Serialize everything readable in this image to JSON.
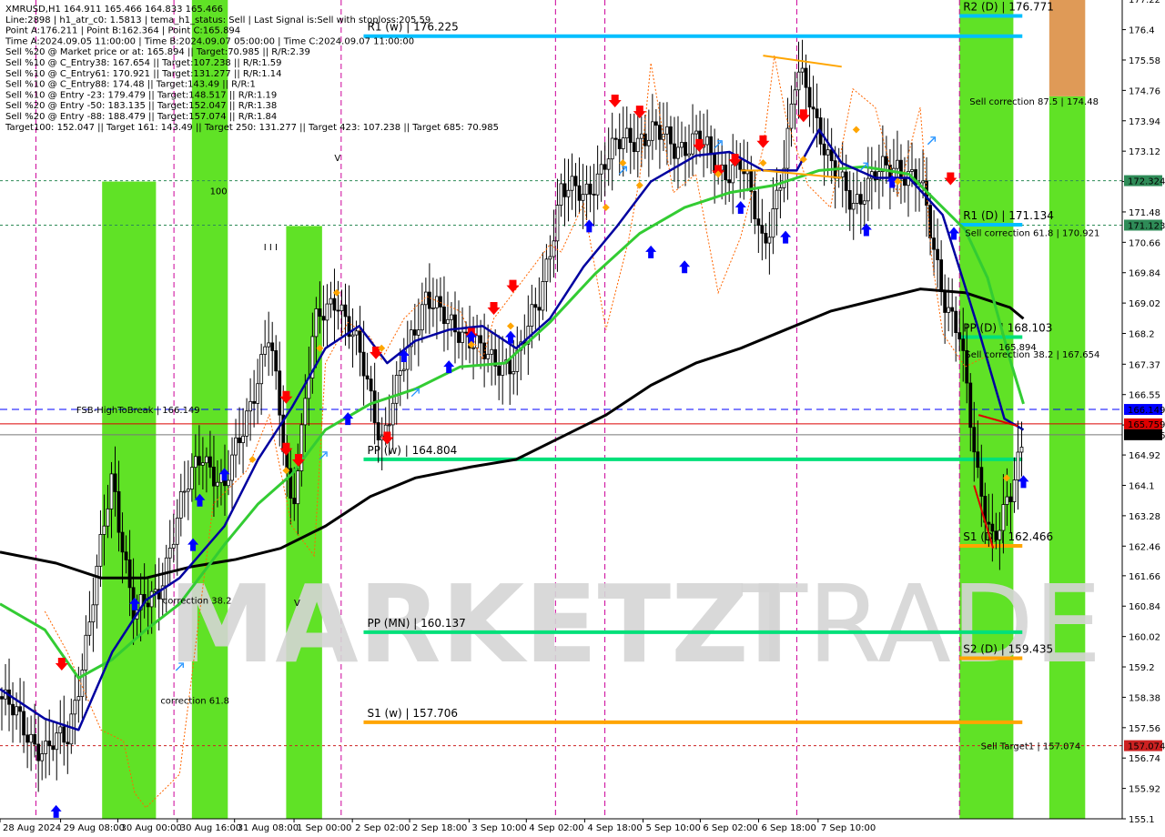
{
  "header": {
    "lines": [
      "XMRUSD,H1  164.911 165.466 164.833 165.466",
      "Line:2898 | h1_atr_c0: 1.5813 | tema_h1_status: Sell | Last Signal is:Sell with stoploss:205.59",
      "Point A:176.211 | Point B:162.364 | Point C:165.894",
      "Time A:2024.09.05 11:00:00 | Time B:2024.09.07 05:00:00 | Time C:2024.09.07 11:00:00",
      "Sell %20 @ Market price or at: 165.894 || Target:70.985 || R/R:2.39",
      "Sell %10 @ C_Entry38: 167.654 || Target:107.238 || R/R:1.59",
      "Sell %10 @ C_Entry61: 170.921 || Target:131.277 || R/R:1.14",
      "Sell %10 @ C_Entry88: 174.48 || Target:143.49 || R/R:1",
      "Sell %10 @ Entry -23: 179.479 || Target:148.517 || R/R:1.19",
      "Sell %20 @ Entry -50: 183.135 || Target:152.047 || R/R:1.38",
      "Sell %20 @ Entry -88: 188.479 || Target:157.074 || R/R:1.84",
      "Target100: 152.047 || Target 161: 143.49 || Target 250: 131.277 || Target 423: 107.238 || Target 685: 70.985"
    ]
  },
  "watermark": {
    "left": "MARKETZI",
    "right": "TRADE"
  },
  "colors": {
    "bull": "#000000",
    "bear": "#000000",
    "ma_slow": "#000000",
    "ma_mid": "#0000a0",
    "ma_fast": "#33cc33",
    "zone_green": "#44dd00",
    "zone_orange": "#d9883a",
    "pivot_green": "#00e07a",
    "pivot_cyan": "#00bfff",
    "pivot_orange": "#ffa500",
    "buy_arrow": "#0000ff",
    "sell_arrow": "#ff0000"
  },
  "chart_data": {
    "type": "candlestick",
    "symbol": "XMRUSD",
    "timeframe": "H1",
    "ylim": [
      155.1,
      177.2
    ],
    "y_ticks": [
      177.22,
      176.4,
      175.58,
      174.76,
      173.94,
      173.12,
      172.3,
      171.48,
      170.66,
      169.84,
      169.02,
      168.2,
      167.37,
      166.55,
      165.73,
      164.92,
      164.1,
      163.28,
      162.46,
      161.66,
      160.84,
      160.02,
      159.2,
      158.38,
      157.56,
      156.74,
      155.92,
      155.1
    ],
    "x_labels": [
      "28 Aug 2024",
      "29 Aug 08:00",
      "30 Aug 00:00",
      "30 Aug 16:00",
      "31 Aug 08:00",
      "1 Sep 00:00",
      "2 Sep 02:00",
      "2 Sep 18:00",
      "3 Sep 10:00",
      "4 Sep 02:00",
      "4 Sep 18:00",
      "5 Sep 10:00",
      "6 Sep 02:00",
      "6 Sep 18:00",
      "7 Sep 10:00"
    ],
    "price_tags": [
      {
        "value": 172.324,
        "label": "172.324",
        "bg": "#2e8b57",
        "fg": "#ffffff"
      },
      {
        "value": 171.123,
        "label": "171.123",
        "bg": "#2e8b57",
        "fg": "#ffffff"
      },
      {
        "value": 166.149,
        "label": "166.149",
        "bg": "#0000ff",
        "fg": "#ffffff"
      },
      {
        "value": 165.759,
        "label": "165.759",
        "bg": "#dd0000",
        "fg": "#ffffff"
      },
      {
        "value": 165.466,
        "label": "165.466",
        "bg": "#000000",
        "fg": "#ffffff"
      },
      {
        "value": 157.074,
        "label": "157.074",
        "bg": "#cc2222",
        "fg": "#ffffff"
      }
    ],
    "levels": [
      {
        "label": "R2 (D) | 176.771",
        "value": 176.771,
        "t0": 0.855,
        "t1": 0.911,
        "color": "#00bfff",
        "text_color": "#000000"
      },
      {
        "label": "R1 (w) | 176.225",
        "value": 176.225,
        "t0": 0.324,
        "t1": 0.911,
        "color": "#00bfff",
        "text_color": "#000000"
      },
      {
        "label": "R1 (D) | 171.134",
        "value": 171.134,
        "t0": 0.855,
        "t1": 0.911,
        "color": "#00bfff",
        "text_color": "#000000"
      },
      {
        "label": "PP (D) | 168.103",
        "value": 168.103,
        "t0": 0.855,
        "t1": 0.911,
        "color": "#00e07a",
        "text_color": "#000000"
      },
      {
        "label": "PP (w) | 164.804",
        "value": 164.804,
        "t0": 0.324,
        "t1": 0.911,
        "color": "#00e07a",
        "text_color": "#000000"
      },
      {
        "label": "S1 (D) | 162.466",
        "value": 162.466,
        "t0": 0.855,
        "t1": 0.911,
        "color": "#ffa500",
        "text_color": "#000000"
      },
      {
        "label": "PP (MN) | 160.137",
        "value": 160.137,
        "t0": 0.324,
        "t1": 0.911,
        "color": "#00e07a",
        "text_color": "#000000"
      },
      {
        "label": "S2 (D) | 159.435",
        "value": 159.435,
        "t0": 0.855,
        "t1": 0.911,
        "color": "#ffa500",
        "text_color": "#000000"
      },
      {
        "label": "S1 (w) | 157.706",
        "value": 157.706,
        "t0": 0.324,
        "t1": 0.911,
        "color": "#ffa500",
        "text_color": "#000000"
      }
    ],
    "dashed_lines": [
      {
        "value": 172.324,
        "color": "#2e8b57",
        "style": "dotted"
      },
      {
        "value": 171.123,
        "color": "#2e8b57",
        "style": "dotted"
      },
      {
        "value": 166.149,
        "color": "#0000ff",
        "style": "dashed"
      },
      {
        "value": 165.759,
        "color": "#dd0000",
        "style": "solid"
      },
      {
        "value": 165.466,
        "color": "#777777",
        "style": "solid"
      },
      {
        "value": 157.074,
        "color": "#cc2222",
        "style": "dotted"
      }
    ],
    "annotations": [
      {
        "text": "Sell correction 87.5 | 174.48",
        "t": 0.864,
        "value": 174.48,
        "color": "#1a1a1a"
      },
      {
        "text": "Sell correction 61.8 | 170.921",
        "t": 0.86,
        "value": 170.921,
        "color": "#1a1a1a"
      },
      {
        "text": "Sell correction 38.2 | 167.654",
        "t": 0.86,
        "value": 167.654,
        "color": "#1a1a1a"
      },
      {
        "text": "165.894",
        "t": 0.89,
        "value": 167.85,
        "color": "#000000"
      },
      {
        "text": "Sell Target1 | 157.074",
        "t": 0.874,
        "value": 157.074,
        "color": "#cc2222"
      },
      {
        "text": "FSB-HighToBreak | 166.149",
        "t": 0.068,
        "value": 166.149,
        "color": "#000000"
      },
      {
        "text": "correction 38.2",
        "t": 0.145,
        "value": 161.0,
        "color": "#0000cc"
      },
      {
        "text": "correction 61.8",
        "t": 0.143,
        "value": 158.3,
        "color": "#0000cc"
      },
      {
        "text": "100",
        "t": 0.187,
        "value": 172.05,
        "color": "#2e8b57"
      },
      {
        "text": "I I I",
        "t": 0.235,
        "value": 170.55,
        "color": "#0000ff"
      },
      {
        "text": "V",
        "t": 0.298,
        "value": 172.95,
        "color": "#0000ff"
      },
      {
        "text": "V",
        "t": 0.262,
        "value": 160.95,
        "color": "#0000ff"
      }
    ],
    "zones": [
      {
        "t0": 0.091,
        "t1": 0.139,
        "lo": 155.1,
        "hi": 172.3,
        "color": "#44dd00"
      },
      {
        "t0": 0.171,
        "t1": 0.203,
        "lo": 155.1,
        "hi": 177.2,
        "color": "#44dd00"
      },
      {
        "t0": 0.255,
        "t1": 0.287,
        "lo": 155.1,
        "hi": 171.1,
        "color": "#44dd00"
      },
      {
        "t0": 0.855,
        "t1": 0.903,
        "lo": 155.1,
        "hi": 177.2,
        "color": "#44dd00"
      },
      {
        "t0": 0.935,
        "t1": 0.967,
        "lo": 155.1,
        "hi": 174.6,
        "color": "#44dd00"
      },
      {
        "t0": 0.935,
        "t1": 0.967,
        "lo": 174.6,
        "hi": 177.2,
        "color": "#d9883a"
      },
      {
        "t0": 1.019,
        "t1": 1.051,
        "lo": 157.0,
        "hi": 177.2,
        "color": "#44dd00"
      }
    ],
    "vlines_t": [
      0.032,
      0.155,
      0.304,
      0.495,
      0.539,
      0.71,
      0.855
    ],
    "ma_slow": [
      [
        0.0,
        162.3
      ],
      [
        0.05,
        162.0
      ],
      [
        0.09,
        161.6
      ],
      [
        0.13,
        161.6
      ],
      [
        0.17,
        161.9
      ],
      [
        0.21,
        162.1
      ],
      [
        0.25,
        162.4
      ],
      [
        0.29,
        163.0
      ],
      [
        0.33,
        163.8
      ],
      [
        0.37,
        164.3
      ],
      [
        0.42,
        164.6
      ],
      [
        0.46,
        164.8
      ],
      [
        0.5,
        165.4
      ],
      [
        0.54,
        166.0
      ],
      [
        0.58,
        166.8
      ],
      [
        0.62,
        167.4
      ],
      [
        0.66,
        167.8
      ],
      [
        0.7,
        168.3
      ],
      [
        0.74,
        168.8
      ],
      [
        0.78,
        169.1
      ],
      [
        0.82,
        169.4
      ],
      [
        0.86,
        169.3
      ],
      [
        0.9,
        168.9
      ],
      [
        0.912,
        168.6
      ]
    ],
    "ma_mid": [
      [
        0.0,
        158.6
      ],
      [
        0.04,
        157.8
      ],
      [
        0.07,
        157.5
      ],
      [
        0.1,
        159.6
      ],
      [
        0.13,
        161.0
      ],
      [
        0.16,
        161.6
      ],
      [
        0.2,
        163.0
      ],
      [
        0.23,
        164.8
      ],
      [
        0.26,
        166.2
      ],
      [
        0.29,
        167.8
      ],
      [
        0.32,
        168.4
      ],
      [
        0.345,
        167.4
      ],
      [
        0.37,
        168.0
      ],
      [
        0.4,
        168.3
      ],
      [
        0.43,
        168.4
      ],
      [
        0.46,
        167.8
      ],
      [
        0.49,
        168.6
      ],
      [
        0.52,
        170.0
      ],
      [
        0.55,
        171.1
      ],
      [
        0.58,
        172.3
      ],
      [
        0.62,
        173.0
      ],
      [
        0.65,
        173.1
      ],
      [
        0.68,
        172.6
      ],
      [
        0.71,
        172.6
      ],
      [
        0.73,
        173.7
      ],
      [
        0.75,
        172.8
      ],
      [
        0.78,
        172.4
      ],
      [
        0.81,
        172.4
      ],
      [
        0.84,
        171.4
      ],
      [
        0.87,
        168.5
      ],
      [
        0.895,
        165.9
      ],
      [
        0.912,
        165.6
      ]
    ],
    "ma_fast": [
      [
        0.0,
        160.9
      ],
      [
        0.04,
        160.2
      ],
      [
        0.07,
        158.9
      ],
      [
        0.1,
        159.4
      ],
      [
        0.13,
        160.2
      ],
      [
        0.16,
        160.9
      ],
      [
        0.2,
        162.5
      ],
      [
        0.23,
        163.6
      ],
      [
        0.26,
        164.4
      ],
      [
        0.29,
        165.6
      ],
      [
        0.33,
        166.3
      ],
      [
        0.37,
        166.7
      ],
      [
        0.41,
        167.3
      ],
      [
        0.45,
        167.4
      ],
      [
        0.49,
        168.5
      ],
      [
        0.53,
        169.8
      ],
      [
        0.57,
        170.9
      ],
      [
        0.61,
        171.6
      ],
      [
        0.65,
        172.0
      ],
      [
        0.69,
        172.2
      ],
      [
        0.73,
        172.6
      ],
      [
        0.77,
        172.7
      ],
      [
        0.81,
        172.5
      ],
      [
        0.84,
        171.6
      ],
      [
        0.86,
        171.0
      ],
      [
        0.88,
        169.7
      ],
      [
        0.9,
        167.5
      ],
      [
        0.912,
        166.3
      ]
    ],
    "price_path": [
      [
        0.0,
        158.4
      ],
      [
        0.02,
        157.6
      ],
      [
        0.04,
        156.9
      ],
      [
        0.06,
        157.3
      ],
      [
        0.08,
        160.4
      ],
      [
        0.1,
        164.4
      ],
      [
        0.12,
        160.5
      ],
      [
        0.14,
        161.2
      ],
      [
        0.16,
        163.4
      ],
      [
        0.18,
        165.1
      ],
      [
        0.2,
        163.9
      ],
      [
        0.22,
        166.1
      ],
      [
        0.24,
        168.1
      ],
      [
        0.26,
        163.5
      ],
      [
        0.28,
        168.3
      ],
      [
        0.3,
        169.3
      ],
      [
        0.32,
        167.6
      ],
      [
        0.34,
        165.4
      ],
      [
        0.36,
        167.3
      ],
      [
        0.38,
        169.4
      ],
      [
        0.4,
        168.3
      ],
      [
        0.42,
        168.2
      ],
      [
        0.44,
        167.2
      ],
      [
        0.46,
        167.6
      ],
      [
        0.48,
        168.9
      ],
      [
        0.5,
        172.2
      ],
      [
        0.52,
        171.8
      ],
      [
        0.54,
        173.0
      ],
      [
        0.56,
        173.4
      ],
      [
        0.58,
        173.7
      ],
      [
        0.6,
        173.2
      ],
      [
        0.62,
        173.5
      ],
      [
        0.64,
        172.6
      ],
      [
        0.66,
        172.8
      ],
      [
        0.68,
        170.6
      ],
      [
        0.7,
        172.9
      ],
      [
        0.71,
        175.2
      ],
      [
        0.72,
        174.9
      ],
      [
        0.74,
        172.6
      ],
      [
        0.76,
        171.8
      ],
      [
        0.78,
        172.4
      ],
      [
        0.8,
        172.8
      ],
      [
        0.82,
        172.2
      ],
      [
        0.84,
        169.4
      ],
      [
        0.855,
        168.1
      ],
      [
        0.87,
        164.5
      ],
      [
        0.885,
        162.7
      ],
      [
        0.9,
        163.6
      ],
      [
        0.912,
        165.4
      ]
    ],
    "stop_trail": [
      [
        0.04,
        160.7
      ],
      [
        0.06,
        159.6
      ],
      [
        0.09,
        157.5
      ],
      [
        0.11,
        157.2
      ],
      [
        0.12,
        155.8
      ],
      [
        0.13,
        155.4
      ],
      [
        0.16,
        156.3
      ],
      [
        0.19,
        163.6
      ],
      [
        0.22,
        164.5
      ],
      [
        0.24,
        166.0
      ],
      [
        0.26,
        163.0
      ],
      [
        0.28,
        162.2
      ],
      [
        0.29,
        167.4
      ],
      [
        0.31,
        168.5
      ],
      [
        0.33,
        168.1
      ],
      [
        0.34,
        167.5
      ],
      [
        0.36,
        168.6
      ],
      [
        0.38,
        169.2
      ],
      [
        0.41,
        168.8
      ],
      [
        0.43,
        167.5
      ],
      [
        0.44,
        168.6
      ],
      [
        0.46,
        169.4
      ],
      [
        0.49,
        170.6
      ],
      [
        0.5,
        170.4
      ],
      [
        0.52,
        171.7
      ],
      [
        0.54,
        168.3
      ],
      [
        0.56,
        170.7
      ],
      [
        0.57,
        172.4
      ],
      [
        0.58,
        175.5
      ],
      [
        0.6,
        172.0
      ],
      [
        0.62,
        172.5
      ],
      [
        0.64,
        169.3
      ],
      [
        0.66,
        170.8
      ],
      [
        0.68,
        173.2
      ],
      [
        0.69,
        175.7
      ],
      [
        0.7,
        174.1
      ],
      [
        0.72,
        172.2
      ],
      [
        0.74,
        171.6
      ],
      [
        0.76,
        174.8
      ],
      [
        0.78,
        174.3
      ],
      [
        0.8,
        171.9
      ],
      [
        0.82,
        174.3
      ],
      [
        0.83,
        170.3
      ],
      [
        0.84,
        168.2
      ],
      [
        0.86,
        167.3
      ],
      [
        0.88,
        167.6
      ]
    ],
    "trend_lines": [
      {
        "t0": 0.68,
        "v0": 175.7,
        "t1": 0.75,
        "v1": 175.4,
        "color": "#ffa500"
      },
      {
        "t0": 0.68,
        "v0": 172.6,
        "t1": 0.75,
        "v1": 172.4,
        "color": "#ffa500"
      },
      {
        "t0": 0.678,
        "v0": 172.6,
        "t1": 0.66,
        "v1": 172.6,
        "color": "#ffa500"
      },
      {
        "t0": 0.872,
        "v0": 166.0,
        "t1": 0.907,
        "v1": 165.7,
        "color": "#dd0000"
      },
      {
        "t0": 0.868,
        "v0": 164.1,
        "t1": 0.885,
        "v1": 162.4,
        "color": "#dd0000"
      }
    ],
    "sell_arrows_t": [
      [
        0.055,
        159.3
      ],
      [
        0.255,
        165.1
      ],
      [
        0.266,
        164.8
      ],
      [
        0.335,
        167.7
      ],
      [
        0.255,
        166.5
      ],
      [
        0.345,
        165.4
      ],
      [
        0.42,
        168.2
      ],
      [
        0.44,
        168.9
      ],
      [
        0.457,
        169.5
      ],
      [
        0.548,
        174.5
      ],
      [
        0.57,
        174.2
      ],
      [
        0.623,
        173.3
      ],
      [
        0.655,
        172.9
      ],
      [
        0.68,
        173.4
      ],
      [
        0.716,
        174.1
      ],
      [
        0.847,
        172.4
      ],
      [
        0.64,
        172.6
      ]
    ],
    "buy_arrows_t": [
      [
        0.05,
        155.3
      ],
      [
        0.12,
        160.9
      ],
      [
        0.172,
        162.5
      ],
      [
        0.178,
        163.7
      ],
      [
        0.2,
        164.4
      ],
      [
        0.31,
        165.9
      ],
      [
        0.42,
        168.1
      ],
      [
        0.36,
        167.6
      ],
      [
        0.4,
        167.3
      ],
      [
        0.455,
        168.1
      ],
      [
        0.525,
        171.1
      ],
      [
        0.58,
        170.4
      ],
      [
        0.61,
        170.0
      ],
      [
        0.66,
        171.6
      ],
      [
        0.7,
        170.8
      ],
      [
        0.772,
        171.0
      ],
      [
        0.795,
        172.3
      ],
      [
        0.85,
        170.9
      ],
      [
        0.912,
        164.2
      ]
    ],
    "blue_hollow_arrows_t": [
      [
        0.16,
        159.2
      ],
      [
        0.288,
        164.9
      ],
      [
        0.37,
        166.6
      ],
      [
        0.555,
        172.6
      ],
      [
        0.64,
        173.3
      ],
      [
        0.77,
        172.7
      ],
      [
        0.83,
        173.4
      ]
    ],
    "orange_dots_t": [
      [
        0.225,
        164.8
      ],
      [
        0.255,
        164.5
      ],
      [
        0.285,
        167.8
      ],
      [
        0.3,
        169.3
      ],
      [
        0.34,
        167.8
      ],
      [
        0.42,
        167.9
      ],
      [
        0.455,
        168.4
      ],
      [
        0.54,
        171.6
      ],
      [
        0.555,
        172.8
      ],
      [
        0.57,
        172.2
      ],
      [
        0.64,
        172.5
      ],
      [
        0.68,
        172.8
      ],
      [
        0.716,
        172.9
      ],
      [
        0.763,
        173.7
      ],
      [
        0.8,
        172.3
      ],
      [
        0.897,
        164.3
      ]
    ]
  }
}
